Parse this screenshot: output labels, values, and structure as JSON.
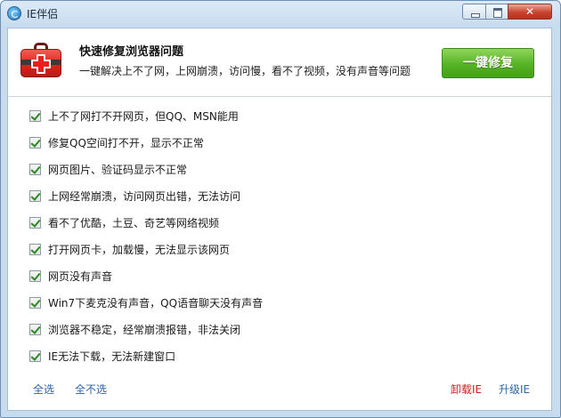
{
  "window": {
    "title": "IE伴侣"
  },
  "titlebar": {
    "close_glyph": "✕"
  },
  "header": {
    "title": "快速修复浏览器问题",
    "subtitle": "一键解决上不了网，上网崩溃，访问慢，看不了视频，没有声音等问题",
    "fix_button": "一键修复"
  },
  "items": [
    {
      "label": "上不了网打不开网页，但QQ、MSN能用",
      "checked": true
    },
    {
      "label": "修复QQ空间打不开，显示不正常",
      "checked": true
    },
    {
      "label": "网页图片、验证码显示不正常",
      "checked": true
    },
    {
      "label": "上网经常崩溃，访问网页出错，无法访问",
      "checked": true
    },
    {
      "label": "看不了优酷，土豆、奇艺等网络视频",
      "checked": true
    },
    {
      "label": "打开网页卡，加载慢，无法显示该网页",
      "checked": true
    },
    {
      "label": "网页没有声音",
      "checked": true
    },
    {
      "label": "Win7下麦克没有声音，QQ语音聊天没有声音",
      "checked": true
    },
    {
      "label": "浏览器不稳定，经常崩溃报错，非法关闭",
      "checked": true
    },
    {
      "label": "IE无法下载，无法新建窗口",
      "checked": true
    }
  ],
  "footer": {
    "select_all": "全选",
    "select_none": "全不选",
    "uninstall": "卸载IE",
    "upgrade": "升级IE"
  },
  "colors": {
    "accent_link": "#2f63a8",
    "danger_link": "#d11f1f",
    "fix_button": "#55b324"
  }
}
